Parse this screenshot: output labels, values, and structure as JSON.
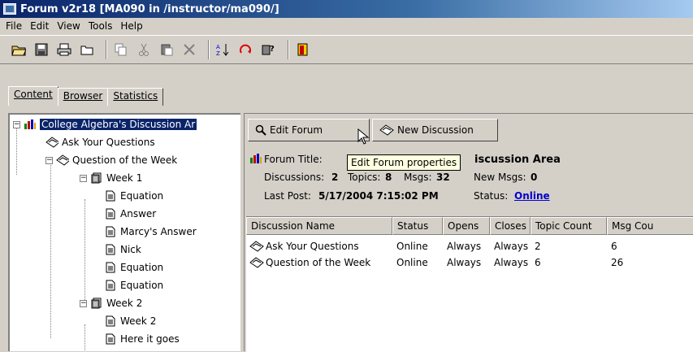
{
  "window": {
    "title": "Forum v2r18  [MA090 in /instructor/ma090/]"
  },
  "menu": [
    "File",
    "Edit",
    "View",
    "Tools",
    "Help"
  ],
  "toolbar": [
    "open-folder-icon",
    "save-icon",
    "print-icon",
    "folder-icon",
    "copy-icon",
    "cut-icon",
    "paste-icon",
    "delete-icon",
    "sort-icon",
    "refresh-icon",
    "help-icon",
    "exit-icon"
  ],
  "tabs": [
    {
      "label": "Content",
      "active": true
    },
    {
      "label": "Browser",
      "active": false
    },
    {
      "label": "Statistics",
      "active": false
    }
  ],
  "tree": {
    "root": "College Algebra's Discussion Ar",
    "items": [
      "Ask Your Questions",
      "Question of the Week",
      "Week 1",
      "Equation",
      "Answer",
      "Marcy's Answer",
      "Nick",
      "Equation",
      "Equation",
      "Week 2",
      "Week 2",
      "Here it goes"
    ]
  },
  "buttons": {
    "edit_forum": "Edit Forum",
    "new_discussion": "New Discussion"
  },
  "tooltip": "Edit Forum properties",
  "forum_info": {
    "title_label": "Forum Title:",
    "title_value": "iscussion Area",
    "discussions_label": "Discussions:",
    "discussions_value": "2",
    "topics_label": "Topics:",
    "topics_value": "8",
    "msgs_label": "Msgs:",
    "msgs_value": "32",
    "newmsgs_label": "New Msgs:",
    "newmsgs_value": "0",
    "lastpost_label": "Last Post:",
    "lastpost_value": "5/17/2004 7:15:02 PM",
    "status_label": "Status:",
    "status_value": "Online"
  },
  "table": {
    "columns": [
      "Discussion Name",
      "Status",
      "Opens",
      "Closes",
      "Topic Count",
      "Msg Cou"
    ],
    "rows": [
      [
        "Ask Your Questions",
        "Online",
        "Always",
        "Always",
        "2",
        "6"
      ],
      [
        "Question of the Week",
        "Online",
        "Always",
        "Always",
        "6",
        "26"
      ]
    ]
  }
}
